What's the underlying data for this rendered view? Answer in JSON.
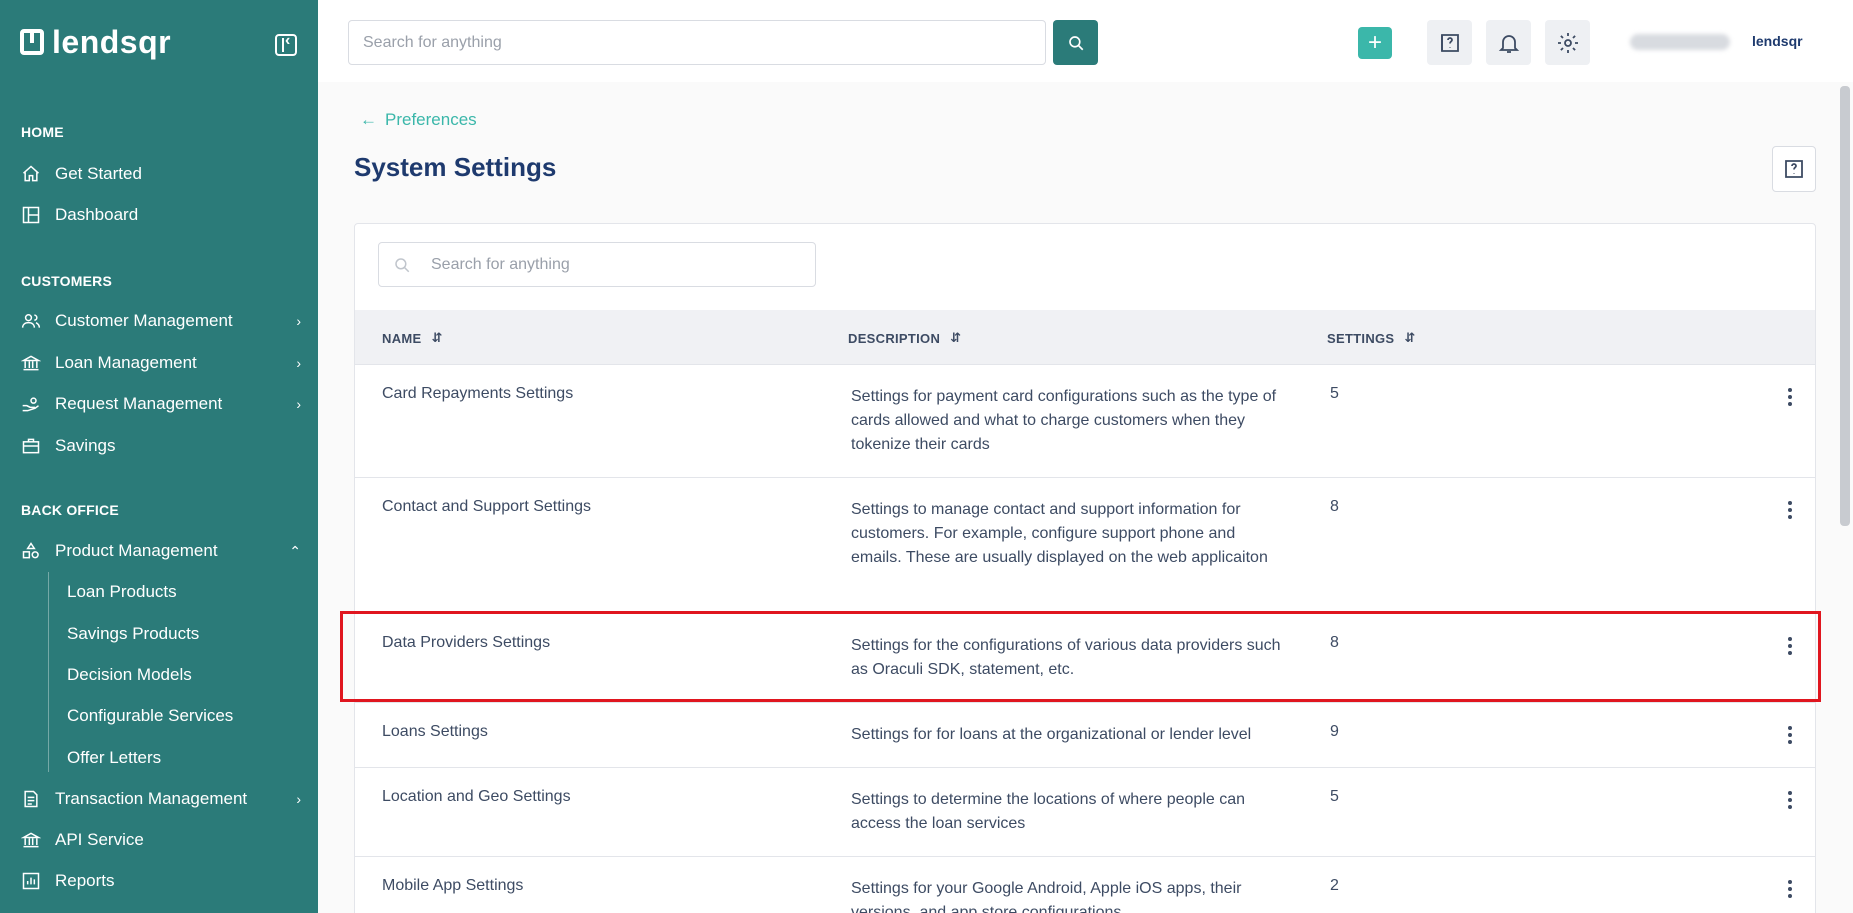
{
  "sidebar": {
    "logo": "lendsqr",
    "sections": {
      "home": "HOME",
      "customers": "CUSTOMERS",
      "back_office": "BACK OFFICE"
    },
    "items": {
      "get_started": "Get Started",
      "dashboard": "Dashboard",
      "customer_management": "Customer Management",
      "loan_management": "Loan Management",
      "request_management": "Request Management",
      "savings": "Savings",
      "product_management": "Product Management",
      "loan_products": "Loan Products",
      "savings_products": "Savings Products",
      "decision_models": "Decision Models",
      "configurable_services": "Configurable Services",
      "offer_letters": "Offer Letters",
      "transaction_management": "Transaction Management",
      "api_service": "API Service",
      "reports": "Reports"
    }
  },
  "topbar": {
    "search_placeholder": "Search for anything",
    "brand_small": "lendsqr"
  },
  "main": {
    "breadcrumb": "Preferences",
    "title": "System Settings",
    "search_placeholder": "Search for anything",
    "columns": [
      "NAME",
      "DESCRIPTION",
      "SETTINGS"
    ],
    "rows": [
      {
        "name": "Card Repayments Settings",
        "description": "Settings for payment card configurations such as the type of cards allowed and what to charge customers when they tokenize their cards",
        "count": "5"
      },
      {
        "name": "Contact and Support Settings",
        "description": "Settings to manage contact and support information for customers. For example, configure support phone and emails. These are usually displayed on the web applicaiton",
        "count": "8"
      },
      {
        "name": "Data Providers Settings",
        "description": "Settings for the configurations of various data providers such as Oraculi SDK, statement, etc.",
        "count": "8"
      },
      {
        "name": "Loans Settings",
        "description": "Settings for for loans at the organizational or lender level",
        "count": "9"
      },
      {
        "name": "Location and Geo Settings",
        "description": "Settings to determine the locations of where people can access the loan services",
        "count": "5"
      },
      {
        "name": "Mobile App Settings",
        "description": "Settings for your Google Android, Apple iOS apps, their versions, and app store configurations",
        "count": "2"
      }
    ]
  },
  "colors": {
    "sidebar_bg": "#2b7b79",
    "accent": "#3bb7aa",
    "title": "#1e3a6e",
    "highlight": "#e0161f"
  }
}
